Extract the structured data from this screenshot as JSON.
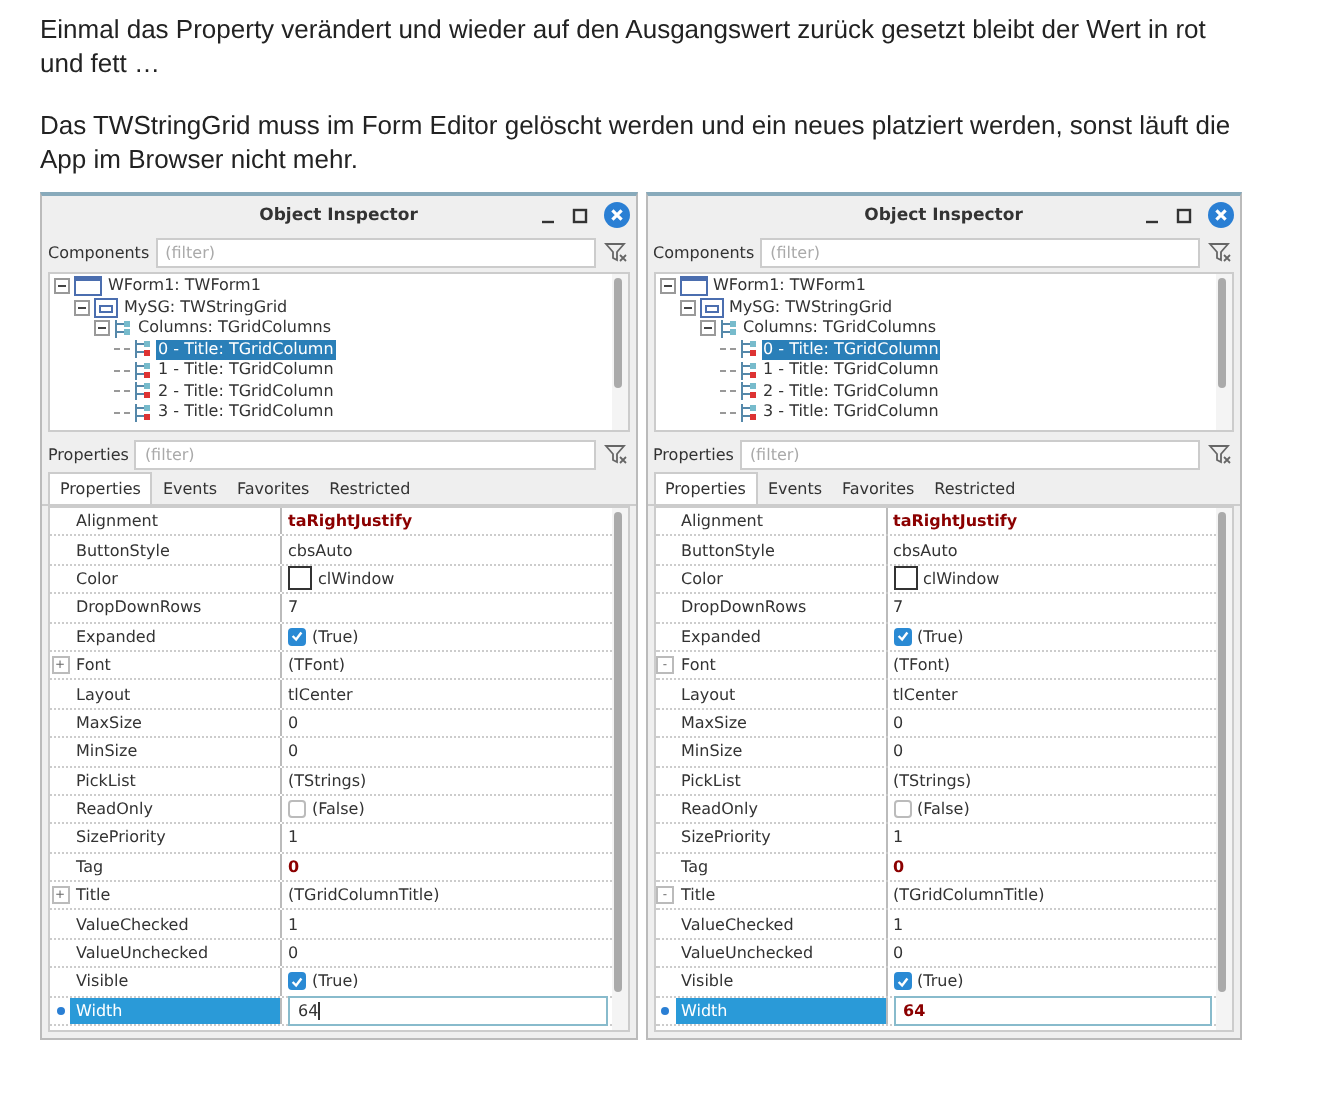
{
  "paragraphs": [
    "Einmal das Property verändert und wieder auf den Ausgangswert zurück gesetzt bleibt der Wert in rot und fett …",
    "Das TWStringGrid muss im Form Editor gelöscht werden und ein neues platziert werden, sonst läuft die App im Browser nicht mehr."
  ],
  "inspectors": [
    {
      "title": "Object Inspector",
      "components_label": "Components",
      "components_filter": {
        "placeholder": "(filter)"
      },
      "tree": [
        {
          "label": "WForm1: TWForm1",
          "kind": "form",
          "expanded": true,
          "selected": false,
          "children": [
            {
              "label": "MySG: TWStringGrid",
              "kind": "grid",
              "expanded": true,
              "selected": false,
              "children": [
                {
                  "label": "Columns: TGridColumns",
                  "kind": "columns",
                  "expanded": true,
                  "selected": false,
                  "children": [
                    {
                      "label": "0 - Title: TGridColumn",
                      "kind": "column",
                      "selected": true
                    },
                    {
                      "label": "1 - Title: TGridColumn",
                      "kind": "column",
                      "selected": false
                    },
                    {
                      "label": "2 - Title: TGridColumn",
                      "kind": "column",
                      "selected": false
                    },
                    {
                      "label": "3 - Title: TGridColumn",
                      "kind": "column",
                      "selected": false
                    }
                  ]
                }
              ]
            }
          ]
        }
      ],
      "properties_label": "Properties",
      "properties_filter": {
        "placeholder": "(filter)"
      },
      "tabs": [
        {
          "label": "Properties",
          "selected": true
        },
        {
          "label": "Events",
          "selected": false
        },
        {
          "label": "Favorites",
          "selected": false
        },
        {
          "label": "Restricted",
          "selected": false
        }
      ],
      "rows": [
        {
          "name": "Alignment",
          "value": "taRightJustify",
          "kind": "text",
          "modified": true,
          "selected": false
        },
        {
          "name": "ButtonStyle",
          "value": "cbsAuto",
          "kind": "text",
          "modified": false,
          "selected": false
        },
        {
          "name": "Color",
          "value": "clWindow",
          "kind": "color",
          "modified": false,
          "selected": false
        },
        {
          "name": "DropDownRows",
          "value": "7",
          "kind": "text",
          "modified": false,
          "selected": false
        },
        {
          "name": "Expanded",
          "value": "(True)",
          "kind": "check",
          "checked": true,
          "modified": false,
          "selected": false
        },
        {
          "name": "Font",
          "value": "(TFont)",
          "kind": "text",
          "expander": "+",
          "modified": false,
          "selected": false
        },
        {
          "name": "Layout",
          "value": "tlCenter",
          "kind": "text",
          "modified": false,
          "selected": false
        },
        {
          "name": "MaxSize",
          "value": "0",
          "kind": "text",
          "modified": false,
          "selected": false
        },
        {
          "name": "MinSize",
          "value": "0",
          "kind": "text",
          "modified": false,
          "selected": false
        },
        {
          "name": "PickList",
          "value": "(TStrings)",
          "kind": "text",
          "modified": false,
          "selected": false
        },
        {
          "name": "ReadOnly",
          "value": "(False)",
          "kind": "check",
          "checked": false,
          "modified": false,
          "selected": false
        },
        {
          "name": "SizePriority",
          "value": "1",
          "kind": "text",
          "modified": false,
          "selected": false
        },
        {
          "name": "Tag",
          "value": "0",
          "kind": "text",
          "modified": true,
          "selected": false
        },
        {
          "name": "Title",
          "value": "(TGridColumnTitle)",
          "kind": "text",
          "expander": "+",
          "modified": false,
          "selected": false
        },
        {
          "name": "ValueChecked",
          "value": "1",
          "kind": "text",
          "modified": false,
          "selected": false
        },
        {
          "name": "ValueUnchecked",
          "value": "0",
          "kind": "text",
          "modified": false,
          "selected": false
        },
        {
          "name": "Visible",
          "value": "(True)",
          "kind": "check",
          "checked": true,
          "modified": false,
          "selected": false
        },
        {
          "name": "Width",
          "value": "64",
          "kind": "text",
          "modified": false,
          "selected": true,
          "editing": true
        }
      ]
    },
    {
      "title": "Object Inspector",
      "components_label": "Components",
      "components_filter": {
        "placeholder": "(filter)"
      },
      "tree": [
        {
          "label": "WForm1: TWForm1",
          "kind": "form",
          "expanded": true,
          "selected": false,
          "children": [
            {
              "label": "MySG: TWStringGrid",
              "kind": "grid",
              "expanded": true,
              "selected": false,
              "children": [
                {
                  "label": "Columns: TGridColumns",
                  "kind": "columns",
                  "expanded": true,
                  "selected": false,
                  "children": [
                    {
                      "label": "0 - Title: TGridColumn",
                      "kind": "column",
                      "selected": true
                    },
                    {
                      "label": "1 - Title: TGridColumn",
                      "kind": "column",
                      "selected": false
                    },
                    {
                      "label": "2 - Title: TGridColumn",
                      "kind": "column",
                      "selected": false
                    },
                    {
                      "label": "3 - Title: TGridColumn",
                      "kind": "column",
                      "selected": false
                    }
                  ]
                }
              ]
            }
          ]
        }
      ],
      "properties_label": "Properties",
      "properties_filter": {
        "placeholder": "(filter)"
      },
      "tabs": [
        {
          "label": "Properties",
          "selected": true
        },
        {
          "label": "Events",
          "selected": false
        },
        {
          "label": "Favorites",
          "selected": false
        },
        {
          "label": "Restricted",
          "selected": false
        }
      ],
      "rows": [
        {
          "name": "Alignment",
          "value": "taRightJustify",
          "kind": "text",
          "modified": true,
          "selected": false
        },
        {
          "name": "ButtonStyle",
          "value": "cbsAuto",
          "kind": "text",
          "modified": false,
          "selected": false
        },
        {
          "name": "Color",
          "value": "clWindow",
          "kind": "color",
          "modified": false,
          "selected": false
        },
        {
          "name": "DropDownRows",
          "value": "7",
          "kind": "text",
          "modified": false,
          "selected": false
        },
        {
          "name": "Expanded",
          "value": "(True)",
          "kind": "check",
          "checked": true,
          "modified": false,
          "selected": false
        },
        {
          "name": "Font",
          "value": "(TFont)",
          "kind": "text",
          "expander": "-",
          "modified": false,
          "selected": false
        },
        {
          "name": "Layout",
          "value": "tlCenter",
          "kind": "text",
          "modified": false,
          "selected": false
        },
        {
          "name": "MaxSize",
          "value": "0",
          "kind": "text",
          "modified": false,
          "selected": false
        },
        {
          "name": "MinSize",
          "value": "0",
          "kind": "text",
          "modified": false,
          "selected": false
        },
        {
          "name": "PickList",
          "value": "(TStrings)",
          "kind": "text",
          "modified": false,
          "selected": false
        },
        {
          "name": "ReadOnly",
          "value": "(False)",
          "kind": "check",
          "checked": false,
          "modified": false,
          "selected": false
        },
        {
          "name": "SizePriority",
          "value": "1",
          "kind": "text",
          "modified": false,
          "selected": false
        },
        {
          "name": "Tag",
          "value": "0",
          "kind": "text",
          "modified": true,
          "selected": false
        },
        {
          "name": "Title",
          "value": "(TGridColumnTitle)",
          "kind": "text",
          "expander": "-",
          "modified": false,
          "selected": false
        },
        {
          "name": "ValueChecked",
          "value": "1",
          "kind": "text",
          "modified": false,
          "selected": false
        },
        {
          "name": "ValueUnchecked",
          "value": "0",
          "kind": "text",
          "modified": false,
          "selected": false
        },
        {
          "name": "Visible",
          "value": "(True)",
          "kind": "check",
          "checked": true,
          "modified": false,
          "selected": false
        },
        {
          "name": "Width",
          "value": "64",
          "kind": "text",
          "modified": true,
          "selected": true,
          "editing": false
        }
      ]
    }
  ]
}
